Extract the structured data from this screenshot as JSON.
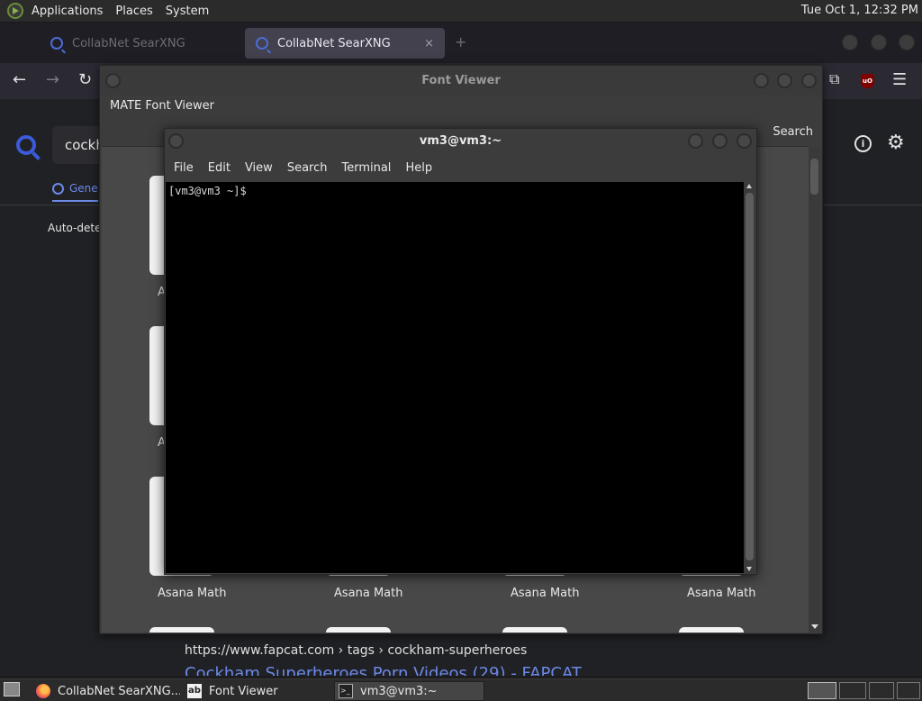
{
  "top_panel": {
    "menus": [
      "Applications",
      "Places",
      "System"
    ],
    "clock": "Tue Oct  1, 12:32 PM"
  },
  "firefox": {
    "tabs": [
      {
        "label": "CollabNet SearXNG",
        "active": false
      },
      {
        "label": "CollabNet SearXNG",
        "active": true
      }
    ],
    "new_tab": "+",
    "tab_close": "×",
    "searxng": {
      "query": "cockh",
      "category_tab": "Gene",
      "autodetect": "Auto-detec",
      "result": {
        "url": "https://www.fapcat.com  › tags › cockham-superheroes",
        "title": "Cockham Superheroes Porn Videos (29) - FAPCAT"
      }
    }
  },
  "font_viewer": {
    "window_title": "Font Viewer",
    "heading": "MATE Font Viewer",
    "search_label": "Search",
    "row_labels": [
      "A",
      "A"
    ],
    "fonts": [
      "Asana Math",
      "Asana Math",
      "Asana Math",
      "Asana Math"
    ]
  },
  "terminal": {
    "window_title": "vm3@vm3:~",
    "menu": [
      "File",
      "Edit",
      "View",
      "Search",
      "Terminal",
      "Help"
    ],
    "prompt": "[vm3@vm3 ~]$"
  },
  "taskbar": {
    "tasks": [
      {
        "label": "CollabNet SearXNG...",
        "icon": "firefox-icon"
      },
      {
        "label": "Font Viewer",
        "icon": "font-viewer-icon"
      },
      {
        "label": "vm3@vm3:~",
        "icon": "terminal-icon"
      }
    ]
  }
}
